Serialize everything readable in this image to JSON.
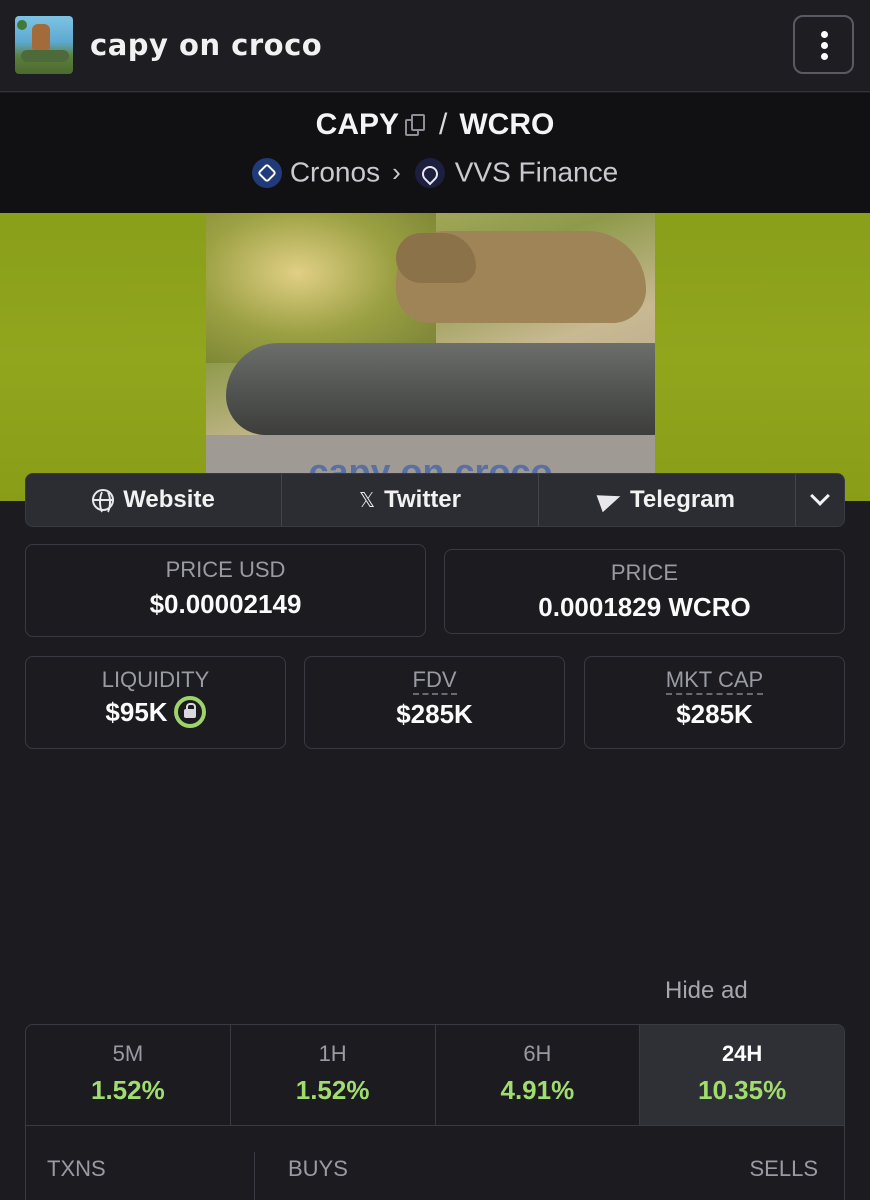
{
  "header": {
    "title": "capy on croco"
  },
  "pair": {
    "base": "CAPY",
    "separator": "/",
    "quote": "WCRO",
    "chain": "Cronos",
    "dex": "VVS Finance"
  },
  "banner": {
    "caption": "capy on croco"
  },
  "links": [
    {
      "label": "Website",
      "icon": "globe-icon"
    },
    {
      "label": "Twitter",
      "icon": "x-icon"
    },
    {
      "label": "Telegram",
      "icon": "telegram-icon"
    }
  ],
  "stats": {
    "price_usd_label": "PRICE USD",
    "price_usd": "$0.00002149",
    "price_label": "PRICE",
    "price": "0.0001829 WCRO",
    "liquidity_label": "LIQUIDITY",
    "liquidity": "$95K",
    "fdv_label": "FDV",
    "fdv": "$285K",
    "mktcap_label": "MKT CAP",
    "mktcap": "$285K"
  },
  "ad": {
    "hide_label": "Hide ad"
  },
  "performance": {
    "tabs": [
      {
        "label": "5M",
        "change": "1.52%"
      },
      {
        "label": "1H",
        "change": "1.52%"
      },
      {
        "label": "6H",
        "change": "4.91%"
      },
      {
        "label": "24H",
        "change": "10.35%"
      }
    ],
    "active": "24H",
    "txns_label": "TXNS",
    "buys_label": "BUYS",
    "sells_label": "SELLS"
  },
  "colors": {
    "background": "#1b1b20",
    "positive": "#a0dc6e",
    "banner": "#8a9f1a"
  }
}
